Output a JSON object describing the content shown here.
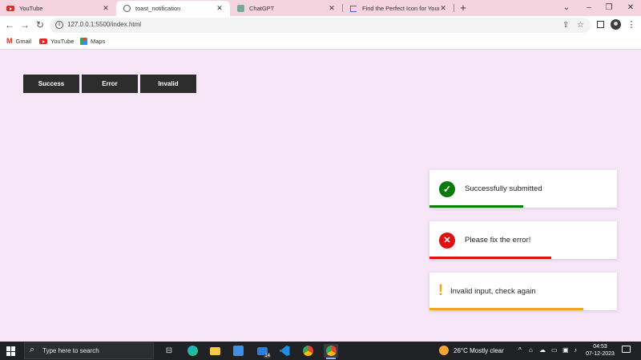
{
  "browser": {
    "tabs": [
      {
        "title": "YouTube",
        "icon": "youtube-icon",
        "active": false
      },
      {
        "title": "toast_notification",
        "icon": "globe-icon",
        "active": true
      },
      {
        "title": "ChatGPT",
        "icon": "chatgpt-icon",
        "active": false
      },
      {
        "title": "Find the Perfect Icon for Your Pr",
        "icon": "flag-icon",
        "active": false
      }
    ],
    "new_tab_label": "+",
    "url": "127.0.0.1:5500/index.html",
    "bookmarks": [
      {
        "label": "Gmail",
        "icon": "gmail-icon"
      },
      {
        "label": "YouTube",
        "icon": "youtube-icon"
      },
      {
        "label": "Maps",
        "icon": "maps-icon"
      }
    ]
  },
  "page": {
    "buttons": [
      {
        "label": "Success"
      },
      {
        "label": "Error"
      },
      {
        "label": "Invalid"
      }
    ],
    "toasts": [
      {
        "type": "success",
        "message": "Successfully submitted",
        "icon": "check-icon",
        "color": "#0a7a0a",
        "progress": 0.5
      },
      {
        "type": "error",
        "message": "Please fix the error!",
        "icon": "close-icon",
        "color": "#e01010",
        "progress": 0.65
      },
      {
        "type": "invalid",
        "message": "Invalid input, check again",
        "icon": "exclamation-icon",
        "color": "#f0a81e",
        "progress": 0.82
      }
    ]
  },
  "taskbar": {
    "search_placeholder": "Type here to search",
    "weather": "26°C  Mostly clear",
    "time": "04:53",
    "date": "07-12-2023",
    "mail_badge": "14"
  }
}
